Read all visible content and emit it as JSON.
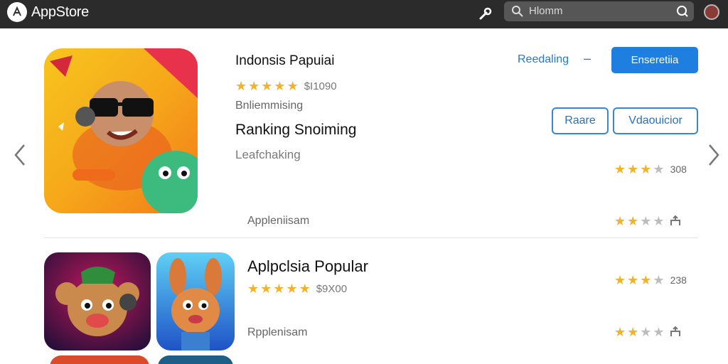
{
  "header": {
    "app_title": "AppStore",
    "search_placeholder": "Hlomm"
  },
  "featured": {
    "title": "Indonsis Papuiai",
    "rating_stars": 5,
    "price": "$I1090",
    "subtitle": "Bnliemmising",
    "headline": "Ranking Snoiming",
    "category": "Leafchaking",
    "link_label": "Reedaling",
    "link_suffix": "–",
    "primary_button": "Enseretiia",
    "secondary_buttons": [
      "Raare",
      "Vdaouicior"
    ],
    "side_rating": {
      "stars": 2.5,
      "count": "308"
    },
    "row_label": "Appleniisam",
    "row_rating": {
      "stars": 2
    }
  },
  "row2": {
    "title": "Aplpclsia Popular",
    "rating_stars": 4.5,
    "price": "$9X00",
    "side_rating": {
      "stars": 2.5,
      "count": "238"
    },
    "row_label": "Rpplenisam",
    "row_rating": {
      "stars": 2
    }
  },
  "colors": {
    "topbar": "#2b2b2b",
    "accent_blue": "#1e7fe0",
    "star_gold": "#f2b32b"
  },
  "icons": [
    "appstore-logo-icon",
    "wrench-icon",
    "search-icon",
    "profile-icon",
    "chevron-left-icon",
    "chevron-right-icon",
    "share-icon"
  ]
}
